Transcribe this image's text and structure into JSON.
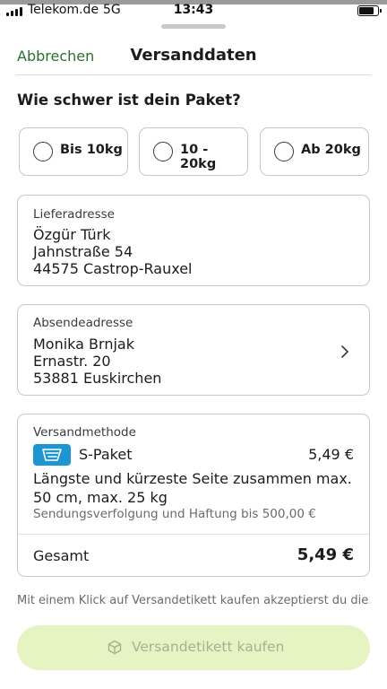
{
  "status_bar": {
    "carrier": "Telekom.de",
    "network": "5G",
    "time": "13:43",
    "battery_level": 0.85
  },
  "header": {
    "cancel_label": "Abbrechen",
    "title": "Versanddaten"
  },
  "weight": {
    "question": "Wie schwer ist dein Paket?",
    "options": [
      {
        "label": "Bis 10kg",
        "selected": false
      },
      {
        "label": "10 - 20kg",
        "selected": false
      },
      {
        "label": "Ab 20kg",
        "selected": false
      }
    ]
  },
  "delivery_address": {
    "caption": "Lieferadresse",
    "name": "Özgür Türk",
    "street": "Jahnstraße 54",
    "city": "44575 Castrop-Rauxel"
  },
  "sender_address": {
    "caption": "Absendeadresse",
    "name": "Monika Brnjak",
    "street": "Ernastr. 20",
    "city": "53881 Euskirchen"
  },
  "shipping": {
    "caption": "Versandmethode",
    "carrier": "S-Paket",
    "price": "5,49 €",
    "description": "Längste und kürzeste Seite zusammen max. 50 cm, max. 25 kg",
    "tracking": "Sendungsverfolgung und Haftung bis 500,00 €",
    "total_label": "Gesamt",
    "total_value": "5,49 €",
    "icon_color": "#1c95d1"
  },
  "consent_text": "Mit einem Klick auf Versandetikett kaufen akzeptierst du die...",
  "buy_button": {
    "label": "Versandetikett kaufen",
    "icon": "package-icon"
  },
  "colors": {
    "accent_green": "#2c6e32",
    "button_bg": "#e6f4c4",
    "button_text": "#a4b18f"
  }
}
